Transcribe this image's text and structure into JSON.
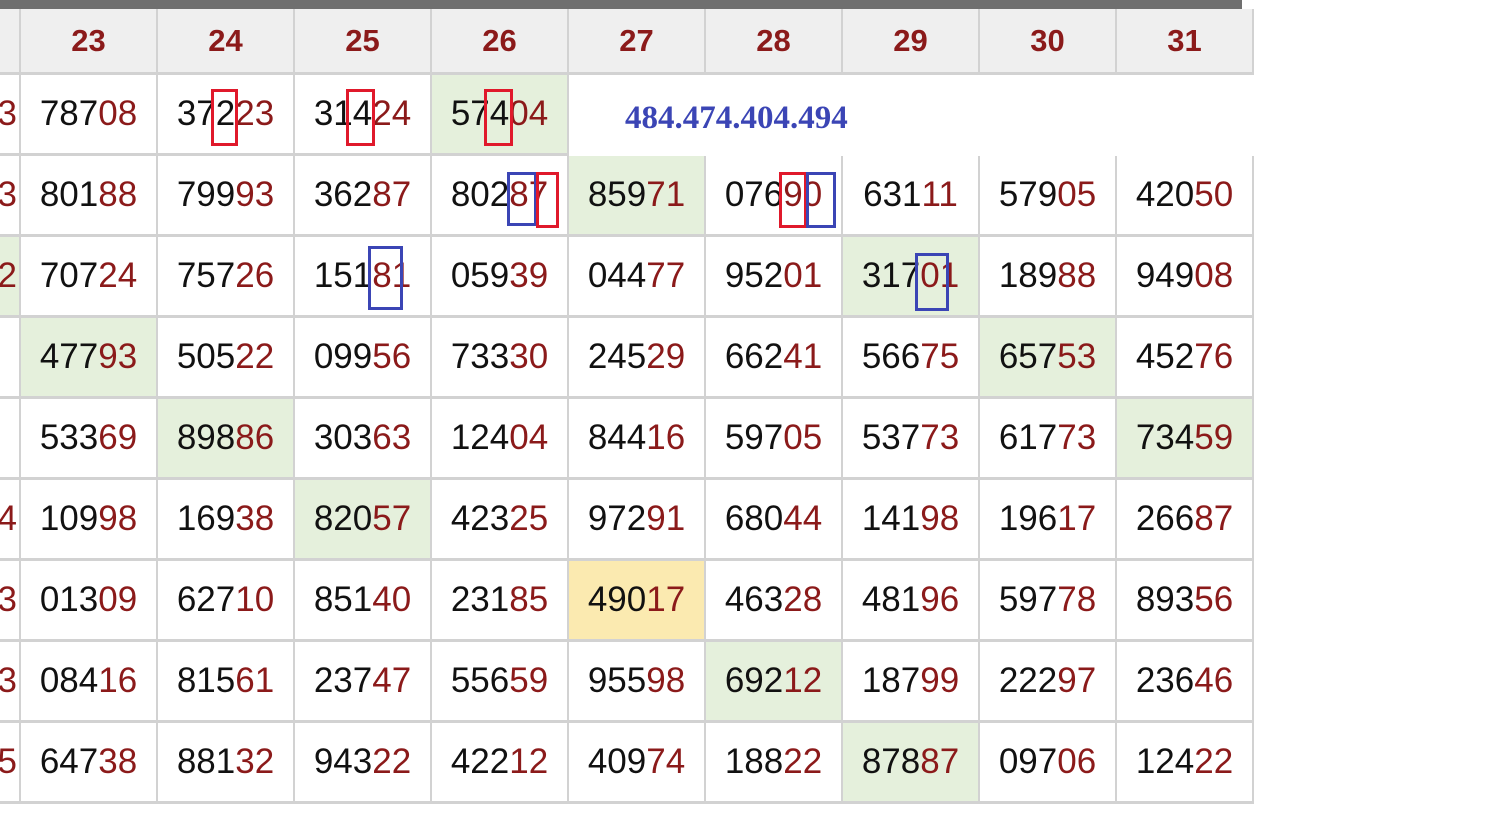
{
  "columns": [
    "23",
    "24",
    "25",
    "26",
    "27",
    "28",
    "29",
    "30",
    "31"
  ],
  "left_stub": [
    "3",
    "3",
    "2",
    "",
    "",
    "4",
    "3",
    "3",
    "5"
  ],
  "rows": [
    [
      "78708",
      "37223",
      "31424",
      "57404",
      "",
      "",
      "",
      "",
      ""
    ],
    [
      "80188",
      "79993",
      "36287",
      "80287",
      "85971",
      "07690",
      "63111",
      "57905",
      "42050"
    ],
    [
      "70724",
      "75726",
      "15181",
      "05939",
      "04477",
      "95201",
      "31701",
      "18988",
      "94908"
    ],
    [
      "47793",
      "50522",
      "09956",
      "73330",
      "24529",
      "66241",
      "56675",
      "65753",
      "45276"
    ],
    [
      "53369",
      "89886",
      "30363",
      "12404",
      "84416",
      "59705",
      "53773",
      "61773",
      "73459"
    ],
    [
      "10998",
      "16938",
      "82057",
      "42325",
      "97291",
      "68044",
      "14198",
      "19617",
      "26687"
    ],
    [
      "01309",
      "62710",
      "85140",
      "23185",
      "49017",
      "46328",
      "48196",
      "59778",
      "89356"
    ],
    [
      "08416",
      "81561",
      "23747",
      "55659",
      "95598",
      "69212",
      "18799",
      "22297",
      "23646"
    ],
    [
      "64738",
      "88132",
      "94322",
      "42212",
      "40974",
      "18822",
      "87887",
      "09706",
      "12422"
    ]
  ],
  "highlights": {
    "green": [
      [
        0,
        3
      ],
      [
        1,
        4
      ],
      [
        2,
        6
      ],
      [
        3,
        0
      ],
      [
        3,
        7
      ],
      [
        4,
        1
      ],
      [
        4,
        8
      ],
      [
        5,
        2
      ],
      [
        7,
        5
      ],
      [
        8,
        6
      ]
    ],
    "yellow": [
      [
        6,
        4
      ]
    ]
  },
  "note": "484.474.404.494",
  "colors": {
    "number_tail": "#8b1a1a",
    "header_text": "#8b1a1a",
    "green_cell": "#e5f0dc",
    "yellow_cell": "#fbeab0",
    "red_box": "#e0192b",
    "blue_box": "#3b45b5"
  }
}
